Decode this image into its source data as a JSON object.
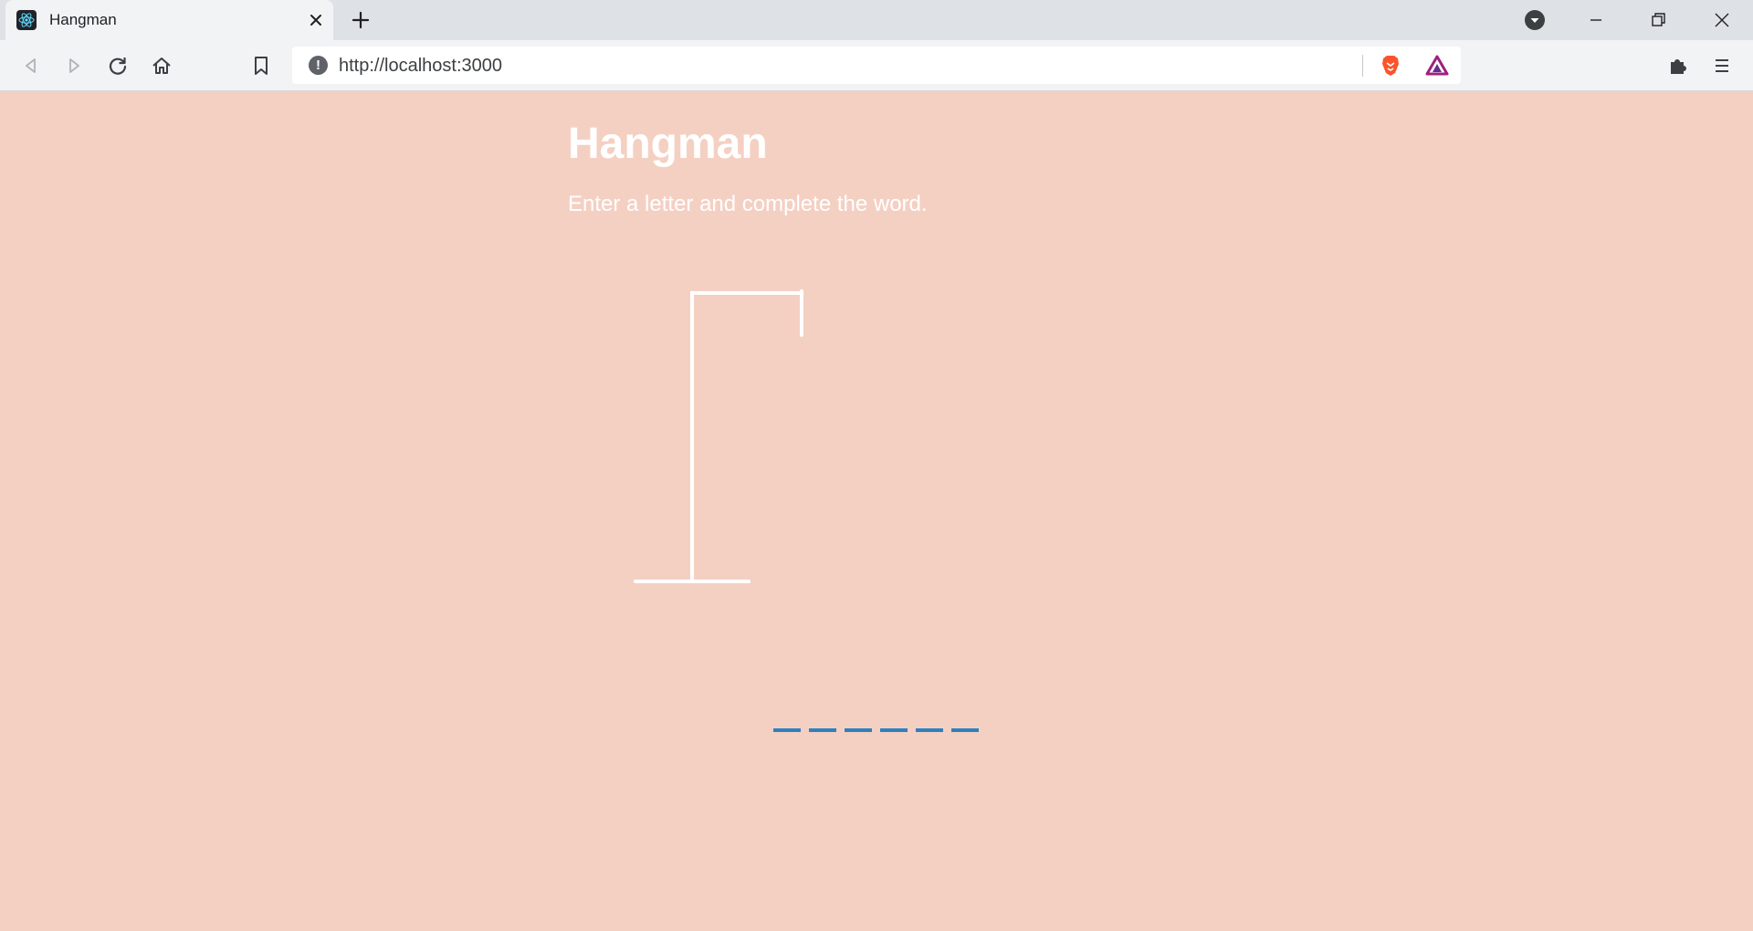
{
  "browser": {
    "tab": {
      "title": "Hangman"
    },
    "address_bar": {
      "url": "http://localhost:3000"
    },
    "icons": {
      "favicon": "react-icon",
      "tab_close": "close-icon",
      "new_tab": "plus-icon",
      "tab_search": "tab-search-icon",
      "minimize": "minimize-icon",
      "restore": "restore-icon",
      "close_window": "close-icon",
      "back": "back-arrow-icon",
      "forward": "forward-arrow-icon",
      "reload": "reload-icon",
      "home": "home-icon",
      "bookmark": "bookmark-icon",
      "site_info": "info-icon",
      "brave_shields": "brave-lion-icon",
      "brave_rewards": "triangle-icon",
      "extensions": "puzzle-icon",
      "menu": "menu-icon"
    }
  },
  "page": {
    "background_color": "#f4d0c3",
    "title": "Hangman",
    "subtitle": "Enter a letter and complete the word.",
    "word": {
      "slot_color": "#2f80c0",
      "slots": [
        "",
        "",
        "",
        "",
        "",
        ""
      ]
    },
    "gallows_color": "#ffffff"
  }
}
